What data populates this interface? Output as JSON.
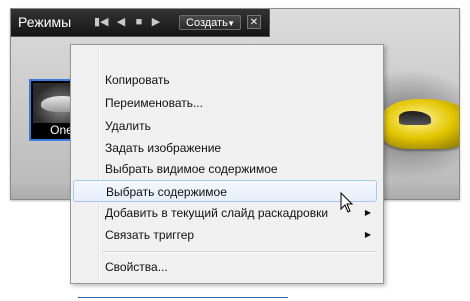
{
  "window": {
    "title": "Режимы",
    "create_button_label": "Создать",
    "create_button_arrow": "▼",
    "close_glyph": "✕",
    "nav_first_glyph": "▮◀",
    "nav_prev_glyph": "◀",
    "nav_stop_glyph": "■",
    "nav_next_glyph": "▶"
  },
  "thumbnail": {
    "label": "One"
  },
  "context_menu": {
    "items": [
      {
        "label": "Копировать"
      },
      {
        "label": "Переименовать..."
      },
      {
        "label": "Удалить"
      },
      {
        "label": "Задать изображение"
      },
      {
        "label": "Выбрать видимое содержимое"
      },
      {
        "label": "Выбрать содержимое"
      },
      {
        "label": "Добавить в текущий слайд раскадровки",
        "submenu": "▶"
      },
      {
        "label": "Связать триггер",
        "submenu": "▶"
      },
      {
        "label": "Свойства..."
      }
    ],
    "highlighted_item": "Выбрать содержимое"
  },
  "colors": {
    "highlight_border": "#a8c8f0",
    "selection_border": "#3b7ddd",
    "car_yellow": "#e3c600"
  }
}
